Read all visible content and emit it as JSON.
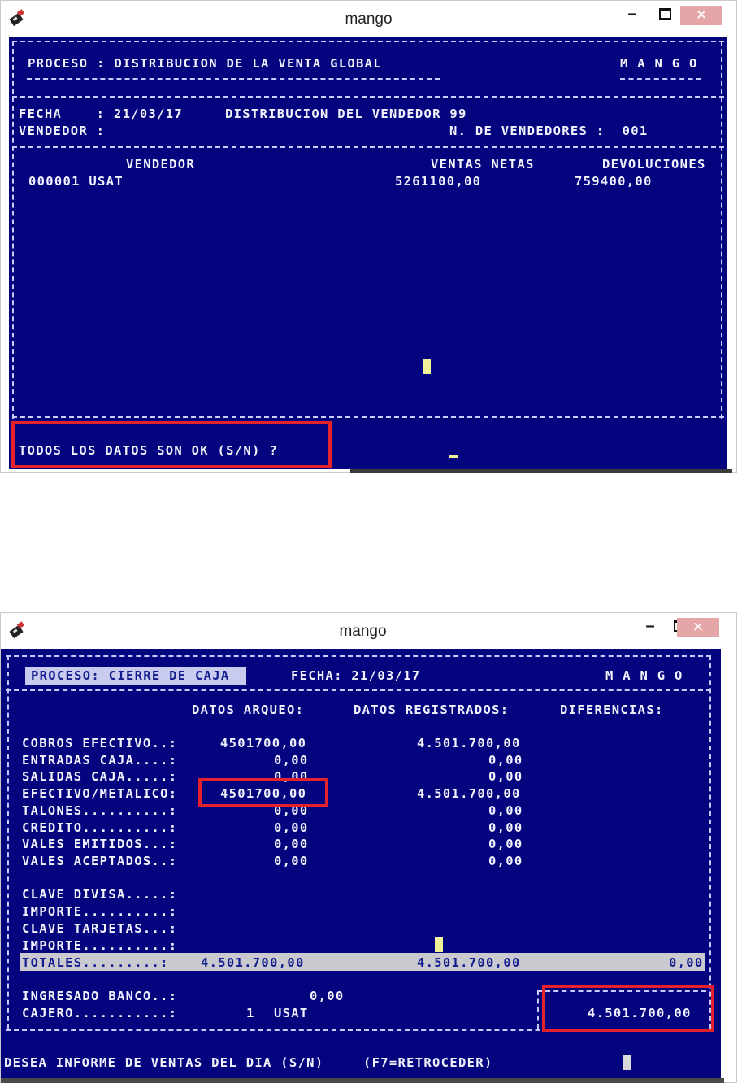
{
  "window1": {
    "title": "mango",
    "controls": {
      "minimize": "–",
      "close": "✕"
    },
    "header": {
      "proceso": "PROCESO : DISTRIBUCION DE LA VENTA GLOBAL",
      "brand": "M A N G O"
    },
    "info": {
      "fecha": "FECHA    : 21/03/17",
      "distribucion": "DISTRIBUCION DEL VENDEDOR 99",
      "vendedor": "VENDEDOR :",
      "n_vendedores": "N. DE VENDEDORES :  001"
    },
    "table": {
      "headers": {
        "vendedor": "VENDEDOR",
        "ventas": "VENTAS NETAS",
        "devoluciones": "DEVOLUCIONES"
      },
      "rows": [
        {
          "vendedor": "000001 USAT",
          "ventas": "5261100,00",
          "devoluciones": "759400,00"
        }
      ]
    },
    "prompt": "TODOS LOS DATOS SON OK (S/N) ?"
  },
  "window2": {
    "title": "mango",
    "controls": {
      "minimize": "–",
      "close": "✕"
    },
    "header": {
      "proceso": "PROCESO: CIERRE DE CAJA",
      "fecha": "FECHA: 21/03/17",
      "brand": "M A N G O"
    },
    "columns": {
      "arqueo": "DATOS ARQUEO:",
      "registrados": "DATOS REGISTRADOS:",
      "diferencias": "DIFERENCIAS:"
    },
    "rows": [
      {
        "label": "COBROS EFECTIVO..:",
        "arqueo": "4501700,00",
        "registrado": "4.501.700,00"
      },
      {
        "label": "ENTRADAS CAJA....:",
        "arqueo": "0,00",
        "registrado": "0,00"
      },
      {
        "label": "SALIDAS CAJA.....:",
        "arqueo": "0,00",
        "registrado": "0,00"
      },
      {
        "label": "EFECTIVO/METALICO:",
        "arqueo": "4501700,00",
        "registrado": "4.501.700,00"
      },
      {
        "label": "TALONES..........:",
        "arqueo": "0,00",
        "registrado": "0,00"
      },
      {
        "label": "CREDITO..........:",
        "arqueo": "0,00",
        "registrado": "0,00"
      },
      {
        "label": "VALES EMITIDOS...:",
        "arqueo": "0,00",
        "registrado": "0,00"
      },
      {
        "label": "VALES ACEPTADOS..:",
        "arqueo": "0,00",
        "registrado": "0,00"
      }
    ],
    "extra": [
      {
        "label": "CLAVE DIVISA.....:"
      },
      {
        "label": "IMPORTE..........:"
      },
      {
        "label": "CLAVE TARJETAS...:"
      },
      {
        "label": "IMPORTE..........:"
      }
    ],
    "totales": {
      "label": "TOTALES.........:",
      "arqueo": "4.501.700,00",
      "registrado": "4.501.700,00",
      "diferencia": "0,00"
    },
    "ingresado": {
      "label": "INGRESADO BANCO..:",
      "value": "0,00"
    },
    "cajero": {
      "label": "CAJERO...........:",
      "num": "1",
      "name": "USAT"
    },
    "box_total": "4.501.700,00",
    "prompt": "DESEA INFORME DE VENTAS DEL DIA (S/N)",
    "hint": "(F7=RETROCEDER)"
  }
}
